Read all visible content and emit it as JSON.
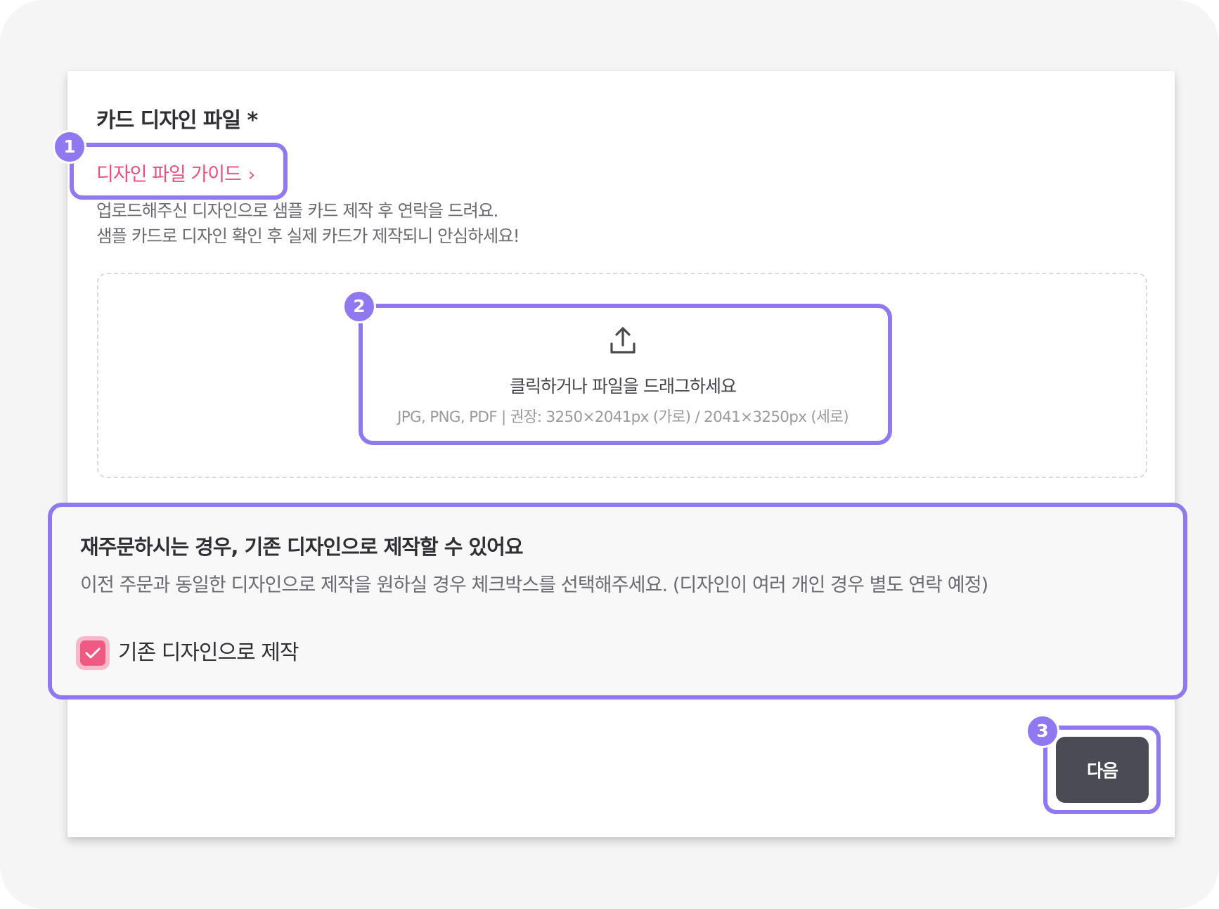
{
  "section": {
    "title": "카드 디자인 파일 *",
    "guide_link": "디자인 파일 가이드",
    "guide_chevron": "›",
    "desc_line1": "업로드해주신 디자인으로 샘플 카드 제작 후 연락을 드려요.",
    "desc_line2": "샘플 카드로 디자인 확인 후 실제 카드가 제작되니 안심하세요!"
  },
  "upload": {
    "icon": "upload-icon",
    "main_text": "클릭하거나 파일을 드래그하세요",
    "hint_text": "JPG, PNG, PDF | 권장: 3250×2041px (가로) / 2041×3250px (세로)"
  },
  "reorder": {
    "title": "재주문하시는 경우, 기존 디자인으로 제작할 수 있어요",
    "desc": "이전 주문과 동일한 디자인으로 제작을 원하실 경우 체크박스를 선택해주세요. (디자인이 여러 개인 경우 별도 연락 예정)",
    "checkbox_label": "기존 디자인으로 제작",
    "checked": true
  },
  "actions": {
    "next_label": "다음"
  },
  "annotations": {
    "badge1": "1",
    "badge2": "2",
    "badge3": "3"
  },
  "colors": {
    "accent_pink": "#ec4f7c",
    "highlight_purple": "#8f78f0",
    "button_dark": "#4b4b55"
  }
}
